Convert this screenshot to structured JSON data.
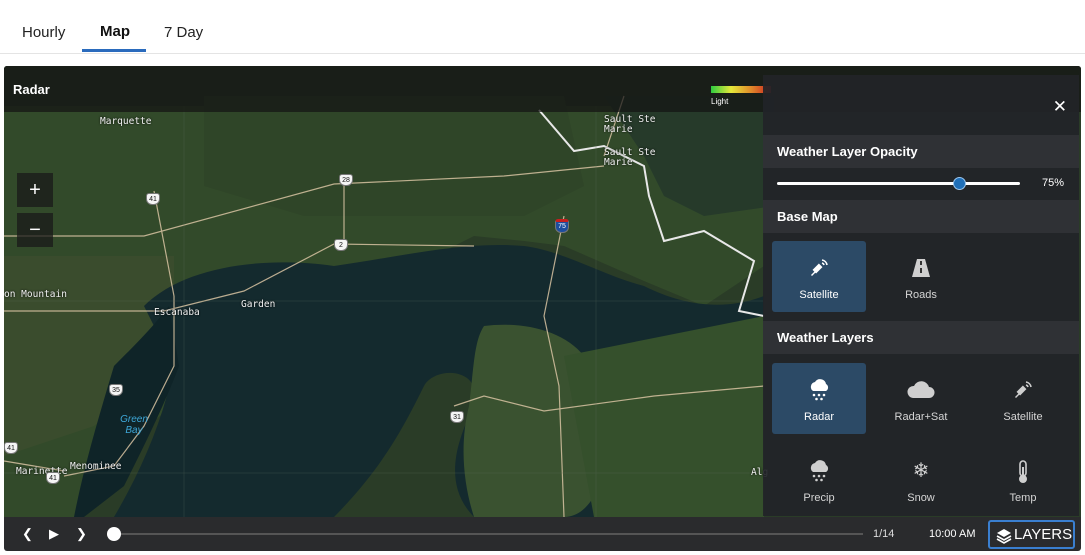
{
  "tabs": [
    {
      "label": "Hourly",
      "active": false
    },
    {
      "label": "Map",
      "active": true
    },
    {
      "label": "7 Day",
      "active": false
    }
  ],
  "map": {
    "title": "Radar",
    "legend": {
      "label": "Light"
    },
    "zoom_in": "+",
    "zoom_out": "−",
    "places": {
      "marquette": "Marquette",
      "sault1": "Sault Ste",
      "sault2": "Marie",
      "sault3": "Sault Ste",
      "sault4": "Marie",
      "iron": "on Mountain",
      "escanaba": "Escanaba",
      "garden": "Garden",
      "marinette": "Marinette",
      "menominee": "Menominee",
      "alger": "Alg"
    },
    "water": {
      "green_bay": "Green Bay"
    },
    "shields": [
      "41",
      "28",
      "2",
      "75",
      "41",
      "35",
      "31",
      "41",
      "41"
    ]
  },
  "layers_panel": {
    "close_icon": "close-icon",
    "opacity": {
      "title": "Weather Layer Opacity",
      "value_label": "75%",
      "value": 0.75
    },
    "base_map": {
      "title": "Base Map",
      "options": [
        {
          "label": "Satellite",
          "icon": "satellite-icon",
          "selected": true
        },
        {
          "label": "Roads",
          "icon": "road-icon",
          "selected": false
        }
      ]
    },
    "weather_layers": {
      "title": "Weather Layers",
      "options": [
        {
          "label": "Radar",
          "icon": "radar-icon",
          "selected": true
        },
        {
          "label": "Radar+Sat",
          "icon": "cloud-icon",
          "selected": false
        },
        {
          "label": "Satellite",
          "icon": "satellite-icon",
          "selected": false
        },
        {
          "label": "Precip",
          "icon": "precip-icon",
          "selected": false
        },
        {
          "label": "Snow",
          "icon": "snowflake-icon",
          "selected": false
        },
        {
          "label": "Temp",
          "icon": "thermometer-icon",
          "selected": false
        }
      ]
    }
  },
  "timeline": {
    "frame": "1/14",
    "time": "10:00 AM",
    "layers_label": "LAYERS",
    "progress": 0
  },
  "colors": {
    "accent": "#2a6bbd",
    "selected_tile": "#2c4a66"
  }
}
